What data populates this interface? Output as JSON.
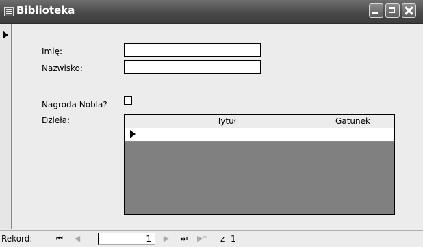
{
  "window": {
    "title": "Biblioteka"
  },
  "form": {
    "first_name_label": "Imię:",
    "first_name_value": "",
    "last_name_label": "Nazwisko:",
    "last_name_value": "",
    "nobel_label": "Nagroda Nobla?",
    "nobel_checked": false,
    "works_label": "Dzieła:"
  },
  "subform": {
    "columns": [
      "Tytuł",
      "Gatunek"
    ],
    "rows": [
      [
        "",
        ""
      ]
    ]
  },
  "navigation": {
    "record_label": "Rekord:",
    "current_record": "1",
    "of_label": "z",
    "total_records": "1"
  },
  "icons": {
    "first": "⏮",
    "prev": "◀",
    "next": "▶",
    "last": "⏭",
    "new": "▶*"
  }
}
